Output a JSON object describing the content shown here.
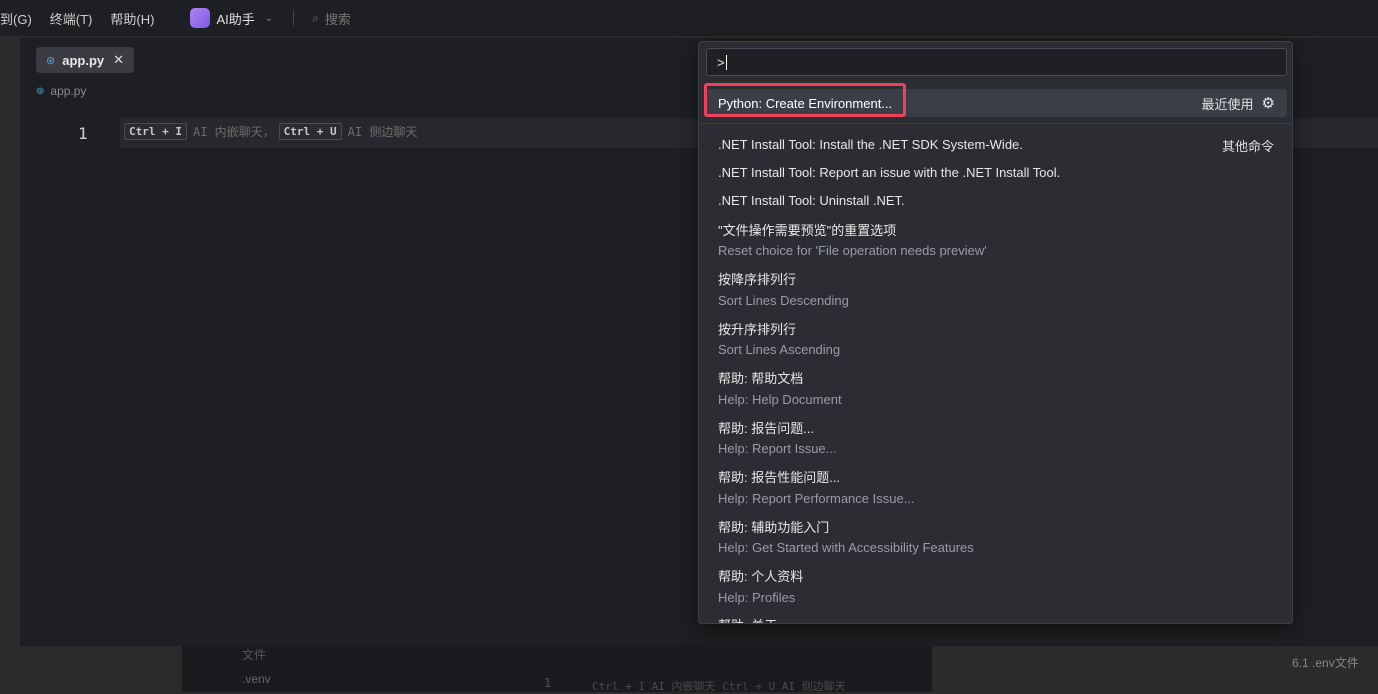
{
  "menubar": {
    "items": [
      "到(G)",
      "终端(T)",
      "帮助(H)"
    ],
    "ai_label": "AI助手",
    "search_label": "搜索"
  },
  "editor": {
    "tab_label": "app.py",
    "breadcrumb": "app.py",
    "line_number": "1",
    "hint": {
      "key1": "Ctrl + I",
      "text1": "AI 内嵌聊天，",
      "key2": "Ctrl + U",
      "text2": "AI 侧边聊天"
    }
  },
  "background": {
    "files_label": "文件",
    "venv_label": ".venv",
    "line_number": "1",
    "hint": "Ctrl + I   AI 内嵌聊天   Ctrl + U   AI 侧边聊天",
    "right_text": "6.1 .env文件"
  },
  "palette": {
    "input_value": ">",
    "first_item": {
      "label": "Python: Create Environment...",
      "right_label": "最近使用"
    },
    "other_commands_label": "其他命令",
    "items": [
      {
        "text": ".NET Install Tool: Install the .NET SDK System-Wide.",
        "sub": false
      },
      {
        "text": ".NET Install Tool: Report an issue with the .NET Install Tool.",
        "sub": false
      },
      {
        "text": ".NET Install Tool: Uninstall .NET.",
        "sub": false
      },
      {
        "text": "\"文件操作需要预览\"的重置选项",
        "sub": false
      },
      {
        "text": "Reset choice for 'File operation needs preview'",
        "sub": true
      },
      {
        "text": "按降序排列行",
        "sub": false
      },
      {
        "text": "Sort Lines Descending",
        "sub": true
      },
      {
        "text": "按升序排列行",
        "sub": false
      },
      {
        "text": "Sort Lines Ascending",
        "sub": true
      },
      {
        "text": "帮助: 帮助文档",
        "sub": false
      },
      {
        "text": "Help: Help Document",
        "sub": true
      },
      {
        "text": "帮助: 报告问题...",
        "sub": false
      },
      {
        "text": "Help: Report Issue...",
        "sub": true
      },
      {
        "text": "帮助: 报告性能问题...",
        "sub": false
      },
      {
        "text": "Help: Report Performance Issue...",
        "sub": true
      },
      {
        "text": "帮助: 辅助功能入门",
        "sub": false
      },
      {
        "text": "Help: Get Started with Accessibility Features",
        "sub": true
      },
      {
        "text": "帮助: 个人资料",
        "sub": false
      },
      {
        "text": "Help: Profiles",
        "sub": true
      },
      {
        "text": "帮助: 关于",
        "sub": false
      }
    ]
  },
  "colors": {
    "highlight_border": "#f0405a",
    "accent_python": "#4fa3d8",
    "ai_logo": "#9b6ef0"
  }
}
